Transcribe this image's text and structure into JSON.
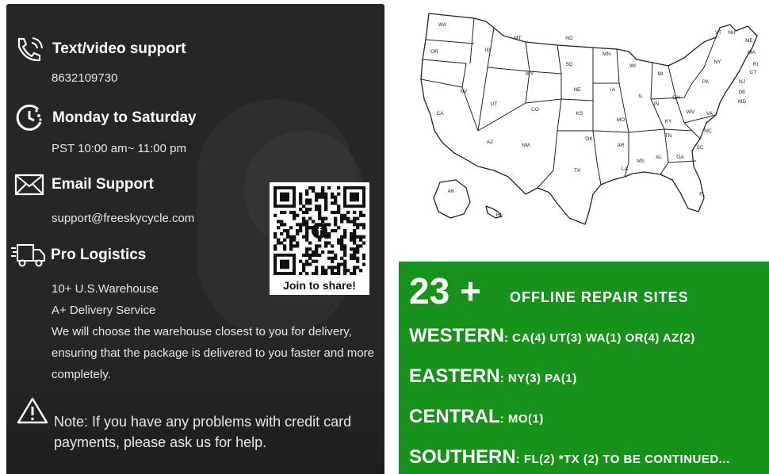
{
  "support": {
    "text_title": "Text/video support",
    "phone": "8632109730",
    "hours_title": "Monday to Saturday",
    "hours": "PST 10:00 am~ 11:00 pm",
    "email_title": "Email Support",
    "email": "support@freeskycycle.com",
    "logistics_title": "Pro Logistics",
    "warehouse": "10+ U.S.Warehouse",
    "delivery": "A+ Delivery Service",
    "description": "We will choose the warehouse closest to you for delivery, ensuring that the package is delivered to you faster and more completely.",
    "note": "Note: If you have any problems with credit card payments, please ask us for help.",
    "qr_caption": "Join to share!"
  },
  "repair": {
    "count": "23 +",
    "label": "OFFLINE REPAIR SITES",
    "regions": [
      {
        "name": "WESTERN",
        "sites": ": CA(4) UT(3) WA(1) OR(4) AZ(2)"
      },
      {
        "name": "EASTERN",
        "sites": ": NY(3) PA(1)"
      },
      {
        "name": "CENTRAL",
        "sites": ": MO(1)"
      },
      {
        "name": "SOUTHERN",
        "sites": ": FL(2) *TX (2) TO BE CONTINUED..."
      }
    ]
  },
  "map_states": [
    "WA",
    "OR",
    "CA",
    "NV",
    "ID",
    "MT",
    "WY",
    "UT",
    "AZ",
    "CO",
    "NM",
    "ND",
    "SD",
    "NE",
    "KS",
    "OK",
    "TX",
    "MN",
    "IA",
    "MO",
    "AR",
    "LA",
    "WI",
    "IL",
    "MS",
    "MI",
    "IN",
    "KY",
    "TN",
    "AL",
    "OH",
    "GA",
    "FL",
    "SC",
    "NC",
    "WV",
    "VA",
    "PA",
    "NY",
    "VT",
    "NH",
    "ME",
    "MA",
    "RI",
    "CT",
    "NJ",
    "DE",
    "MD",
    "AK",
    "HI"
  ],
  "colors": {
    "green": "#17921b",
    "dark": "#262626"
  }
}
